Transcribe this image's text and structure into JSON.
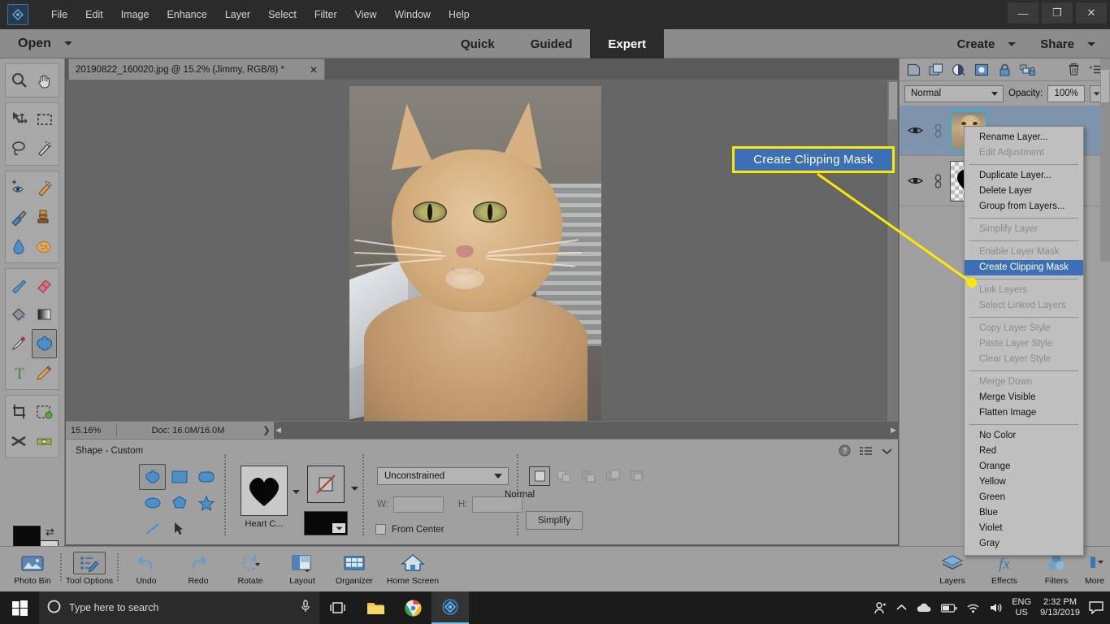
{
  "titlebar": {
    "app_icon": "photoshop-elements-logo",
    "menus": [
      "File",
      "Edit",
      "Image",
      "Enhance",
      "Layer",
      "Select",
      "Filter",
      "View",
      "Window",
      "Help"
    ],
    "window_controls": {
      "minimize": "—",
      "restore": "❐",
      "close": "✕"
    }
  },
  "modebar": {
    "open_label": "Open",
    "tabs": [
      {
        "label": "Quick",
        "active": false
      },
      {
        "label": "Guided",
        "active": false
      },
      {
        "label": "Expert",
        "active": true
      }
    ],
    "create_label": "Create",
    "share_label": "Share"
  },
  "toolbar": {
    "tools": [
      {
        "name": "zoom-tool",
        "glyph": "zoom"
      },
      {
        "name": "hand-tool",
        "glyph": "hand"
      },
      {
        "name": "move-tool",
        "glyph": "move"
      },
      {
        "name": "rectangular-marquee-tool",
        "glyph": "marquee"
      },
      {
        "name": "lasso-tool",
        "glyph": "lasso"
      },
      {
        "name": "quick-selection-tool",
        "glyph": "wand"
      },
      {
        "name": "red-eye-removal-tool",
        "glyph": "eye-plus"
      },
      {
        "name": "spot-healing-brush-tool",
        "glyph": "healing"
      },
      {
        "name": "smart-brush-tool",
        "glyph": "smart-brush"
      },
      {
        "name": "clone-stamp-tool",
        "glyph": "stamp"
      },
      {
        "name": "blur-tool",
        "glyph": "drop"
      },
      {
        "name": "sponge-tool",
        "glyph": "sponge"
      },
      {
        "name": "brush-tool",
        "glyph": "brush"
      },
      {
        "name": "eraser-tool",
        "glyph": "eraser"
      },
      {
        "name": "paint-bucket-tool",
        "glyph": "bucket"
      },
      {
        "name": "gradient-tool",
        "glyph": "gradient"
      },
      {
        "name": "color-picker-tool",
        "glyph": "eyedropper"
      },
      {
        "name": "custom-shape-tool",
        "glyph": "shape",
        "selected": true
      },
      {
        "name": "type-tool",
        "glyph": "type"
      },
      {
        "name": "pencil-tool",
        "glyph": "pencil"
      },
      {
        "name": "crop-tool",
        "glyph": "crop"
      },
      {
        "name": "content-aware-move-tool",
        "glyph": "content-move"
      },
      {
        "name": "recompose-tool",
        "glyph": "recompose"
      },
      {
        "name": "straighten-tool",
        "glyph": "straighten"
      }
    ],
    "foreground_color": "#0a0a0a",
    "background_color": "#d2d2d2"
  },
  "document": {
    "tab_title": "20190822_160020.jpg @ 15.2% (Jimmy, RGB/8) *",
    "close_glyph": "✕"
  },
  "statusbar": {
    "zoom": "15.16%",
    "doc_info": "Doc: 16.0M/16.0M",
    "expand_glyph": "❯"
  },
  "options": {
    "title": "Shape - Custom",
    "shape_label": "Heart C...",
    "constrain_value": "Unconstrained",
    "w_label": "W:",
    "h_label": "H:",
    "w_value": "",
    "h_value": "",
    "from_center_label": "From Center",
    "area_mode_label": "Normal",
    "simplify_label": "Simplify",
    "help_icon": "question-mark-icon",
    "more_icon": "panel-menu-icon",
    "collapse_icon": "chevron-down-icon"
  },
  "layers_panel": {
    "tool_icons": [
      "new-layer-icon",
      "duplicate-layer-icon",
      "adjustment-layer-icon",
      "layer-mask-icon",
      "lock-transparency-icon",
      "lock-all-icon",
      "delete-layer-icon",
      "panel-menu-icon"
    ],
    "blend_mode": "Normal",
    "opacity_label": "Opacity:",
    "opacity_value": "100%",
    "layers": [
      {
        "name": "photo-layer",
        "thumb": "cat-photo",
        "visible": true,
        "selected": true,
        "linked": true
      },
      {
        "name": "heart-shape-layer",
        "thumb": "heart-shape",
        "visible": true,
        "selected": false,
        "linked": true
      }
    ]
  },
  "context_menu": {
    "items": [
      {
        "label": "Rename Layer...",
        "state": "enabled"
      },
      {
        "label": "Edit Adjustment",
        "state": "disabled"
      },
      {
        "separator": true
      },
      {
        "label": "Duplicate Layer...",
        "state": "enabled"
      },
      {
        "label": "Delete Layer",
        "state": "enabled"
      },
      {
        "label": "Group from Layers...",
        "state": "enabled"
      },
      {
        "separator": true
      },
      {
        "label": "Simplify Layer",
        "state": "disabled"
      },
      {
        "separator": true
      },
      {
        "label": "Enable Layer Mask",
        "state": "disabled"
      },
      {
        "label": "Create Clipping Mask",
        "state": "highlighted"
      },
      {
        "separator": true
      },
      {
        "label": "Link Layers",
        "state": "disabled"
      },
      {
        "label": "Select Linked Layers",
        "state": "disabled"
      },
      {
        "separator": true
      },
      {
        "label": "Copy Layer Style",
        "state": "disabled"
      },
      {
        "label": "Paste Layer Style",
        "state": "disabled"
      },
      {
        "label": "Clear Layer Style",
        "state": "disabled"
      },
      {
        "separator": true
      },
      {
        "label": "Merge Down",
        "state": "disabled"
      },
      {
        "label": "Merge Visible",
        "state": "enabled"
      },
      {
        "label": "Flatten Image",
        "state": "enabled"
      },
      {
        "separator": true
      },
      {
        "label": "No Color",
        "state": "enabled"
      },
      {
        "label": "Red",
        "state": "enabled"
      },
      {
        "label": "Orange",
        "state": "enabled"
      },
      {
        "label": "Yellow",
        "state": "enabled"
      },
      {
        "label": "Green",
        "state": "enabled"
      },
      {
        "label": "Blue",
        "state": "enabled"
      },
      {
        "label": "Violet",
        "state": "enabled"
      },
      {
        "label": "Gray",
        "state": "enabled"
      }
    ]
  },
  "callout": {
    "text": "Create Clipping Mask",
    "border_color": "#ffe800",
    "fill_color": "#3c6fb5",
    "text_color": "#ffffff",
    "leader_color": "#ffe800"
  },
  "bottom_bar": {
    "left_items": [
      {
        "label": "Photo Bin",
        "icon": "photo-bin-icon",
        "selected": false
      },
      {
        "label": "Tool Options",
        "icon": "tool-options-icon",
        "selected": true
      },
      {
        "label": "Undo",
        "icon": "undo-icon",
        "selected": false
      },
      {
        "label": "Redo",
        "icon": "redo-icon",
        "selected": false
      },
      {
        "label": "Rotate",
        "icon": "rotate-icon",
        "selected": false
      },
      {
        "label": "Layout",
        "icon": "layout-icon",
        "selected": false
      },
      {
        "label": "Organizer",
        "icon": "organizer-icon",
        "selected": false
      },
      {
        "label": "Home Screen",
        "icon": "home-screen-icon",
        "selected": false
      }
    ],
    "right_items": [
      {
        "label": "Layers",
        "icon": "layers-icon",
        "selected": false
      },
      {
        "label": "Effects",
        "icon": "effects-fx-icon",
        "selected": false
      },
      {
        "label": "Filters",
        "icon": "filters-icon",
        "selected": false
      },
      {
        "label": "More",
        "icon": "more-icon",
        "selected": false
      }
    ]
  },
  "taskbar": {
    "start_icon": "windows-start-icon",
    "search_placeholder": "Type here to search",
    "search_icon": "search-circle-icon",
    "mic_icon": "microphone-icon",
    "pinned": [
      {
        "name": "task-view-icon"
      },
      {
        "name": "file-explorer-icon"
      },
      {
        "name": "chrome-icon"
      },
      {
        "name": "photoshop-elements-icon",
        "active": true
      }
    ],
    "tray": {
      "people_icon": "people-icon",
      "chevron_icon": "show-hidden-icons-icon",
      "onedrive_icon": "onedrive-cloud-icon",
      "battery_icon": "battery-icon",
      "wifi_icon": "wifi-icon",
      "volume_icon": "volume-icon",
      "language_line1": "ENG",
      "language_line2": "US",
      "time": "2:32 PM",
      "date": "9/13/2019",
      "notification_icon": "action-center-icon"
    }
  }
}
